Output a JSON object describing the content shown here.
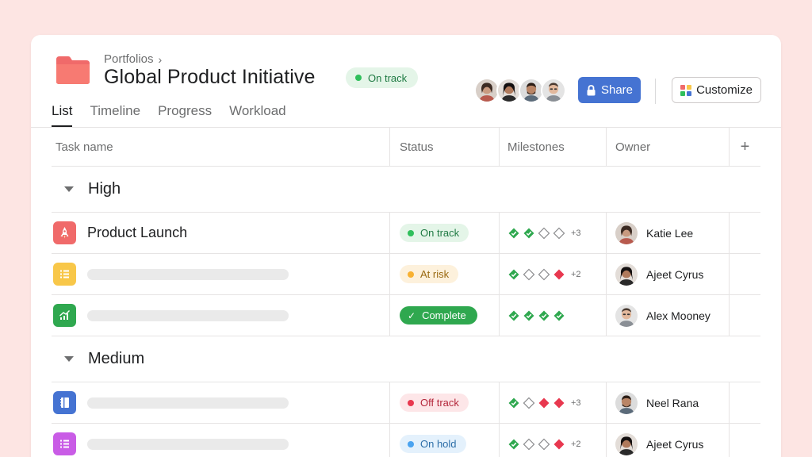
{
  "header": {
    "breadcrumb": "Portfolios",
    "title": "Global Product Initiative",
    "status": {
      "label": "On track",
      "color": "#2fbf5b"
    },
    "share_label": "Share",
    "customize_label": "Customize",
    "members": [
      "member-1",
      "member-2",
      "member-3",
      "member-4"
    ]
  },
  "tabs": [
    {
      "label": "List",
      "active": true
    },
    {
      "label": "Timeline",
      "active": false
    },
    {
      "label": "Progress",
      "active": false
    },
    {
      "label": "Workload",
      "active": false
    }
  ],
  "columns": {
    "task": "Task name",
    "status": "Status",
    "milestones": "Milestones",
    "owner": "Owner",
    "add": "+"
  },
  "sections": [
    {
      "label": "High",
      "rows": [
        {
          "icon": "rocket-icon",
          "icon_color": "#f06a6a",
          "name": "Product Launch",
          "status": "On track",
          "status_kind": "on-track",
          "milestones": [
            "done",
            "done",
            "open",
            "open"
          ],
          "more": "+3",
          "owner": "Katie Lee"
        },
        {
          "icon": "list-icon",
          "icon_color": "#f8c749",
          "name": "",
          "status": "At risk",
          "status_kind": "at-risk",
          "milestones": [
            "done",
            "open",
            "open",
            "missed"
          ],
          "more": "+2",
          "owner": "Ajeet Cyrus"
        },
        {
          "icon": "chart-icon",
          "icon_color": "#2fa84f",
          "name": "",
          "status": "Complete",
          "status_kind": "complete",
          "milestones": [
            "done",
            "done",
            "done",
            "done"
          ],
          "more": "",
          "owner": "Alex Mooney"
        }
      ]
    },
    {
      "label": "Medium",
      "rows": [
        {
          "icon": "notebook-icon",
          "icon_color": "#4573d2",
          "name": "",
          "status": "Off track",
          "status_kind": "off-track",
          "milestones": [
            "done",
            "open",
            "missed",
            "missed"
          ],
          "more": "+3",
          "owner": "Neel Rana"
        },
        {
          "icon": "list-icon",
          "icon_color": "#c95ce6",
          "name": "",
          "status": "On hold",
          "status_kind": "on-hold",
          "milestones": [
            "done",
            "open",
            "open",
            "missed"
          ],
          "more": "+2",
          "owner": "Ajeet Cyrus"
        }
      ]
    }
  ],
  "colors": {
    "background": "#fde5e3",
    "accent": "#4573d2",
    "on_track": "#2fbf5b",
    "at_risk": "#f8b131",
    "off_track": "#e8384f",
    "on_hold": "#4aa3f0",
    "complete": "#2fa84f"
  }
}
